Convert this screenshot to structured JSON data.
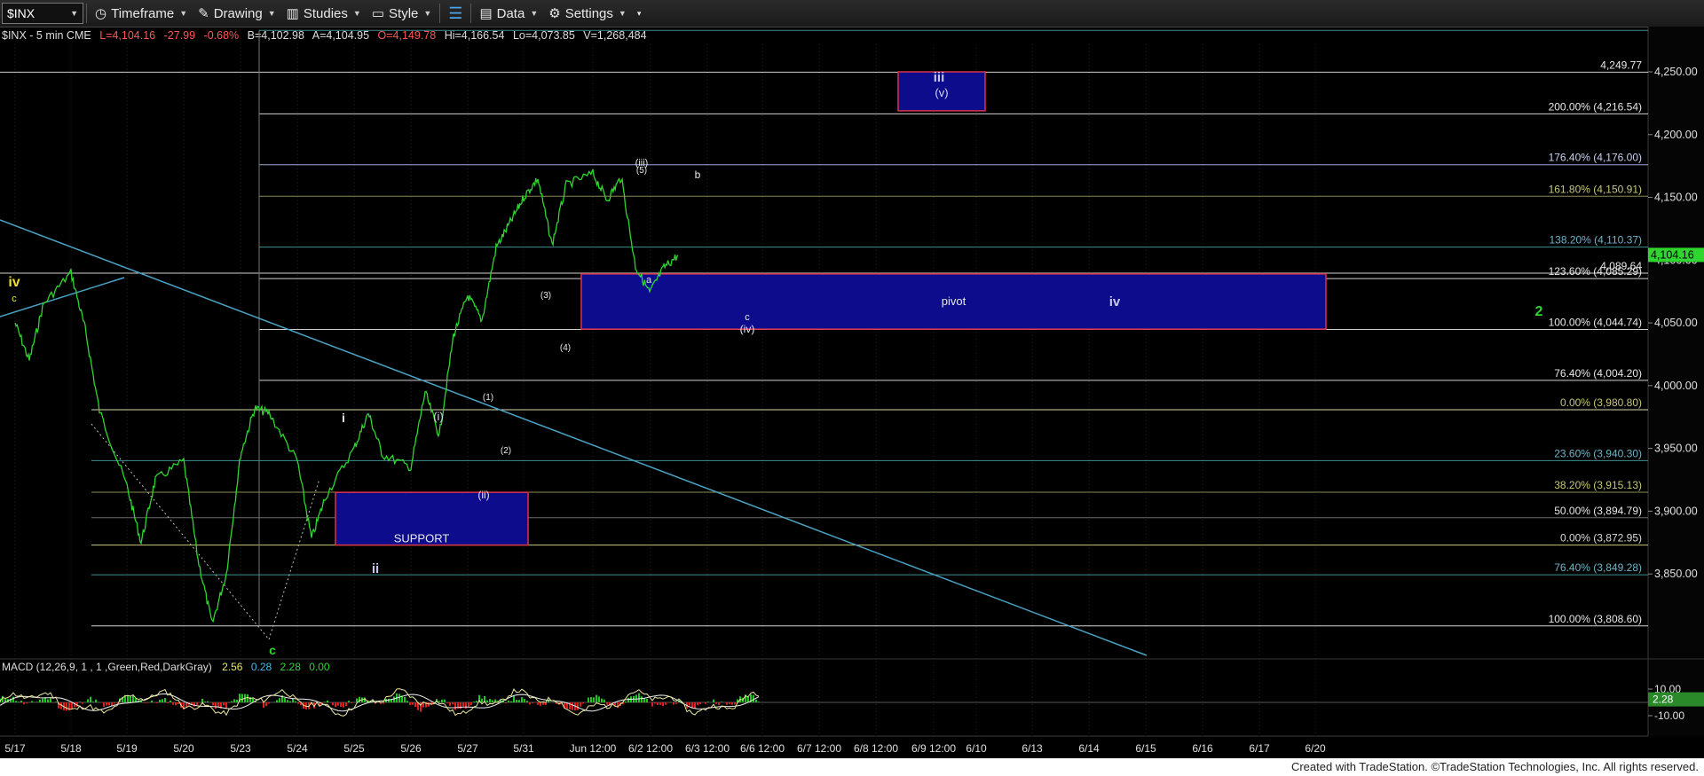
{
  "toolbar": {
    "symbol": "$INX",
    "timeframe": "Timeframe",
    "drawing": "Drawing",
    "studies": "Studies",
    "style": "Style",
    "data": "Data",
    "settings": "Settings"
  },
  "info": {
    "symbol": "$INX - 5 min CME",
    "last": "L=4,104.16",
    "change": "-27.99",
    "pct": "-0.68%",
    "bid": "B=4,102.98",
    "ask": "A=4,104.95",
    "open": "O=4,149.78",
    "hi": "Hi=4,166.54",
    "lo": "Lo=4,073.85",
    "vol": "V=1,268,484"
  },
  "colors": {
    "background": "#000000",
    "price": "#2fd62f",
    "fib_yellow": "#c6c67a",
    "fib_cyan": "#6fb3c8",
    "fib_white": "#d8d8d8",
    "box_fill": "#0c0c8c",
    "box_border": "#d8344a",
    "trendline": "#4aa3c4",
    "macd_line": "#e8e8a0",
    "signal_line": "#f0f0f0",
    "hist_pos": "#1ec81e",
    "hist_neg": "#e02020"
  },
  "chart_data": {
    "type": "line",
    "x_ticks": [
      "5/17",
      "5/18",
      "5/19",
      "5/20",
      "5/23",
      "5/24",
      "5/25",
      "5/26",
      "5/27",
      "5/31",
      "Jun 12:00",
      "6/2 12:00",
      "6/3 12:00",
      "6/6 12:00",
      "6/7 12:00",
      "6/8 12:00",
      "6/9 12:00",
      "6/10",
      "6/13",
      "6/14",
      "6/15",
      "6/16",
      "6/17",
      "6/20"
    ],
    "y_ticks": [
      "4,250.00",
      "4,200.00",
      "4,150.00",
      "4,100.00",
      "4,050.00",
      "4,000.00",
      "3,950.00",
      "3,900.00",
      "3,850.00"
    ],
    "ylim": [
      3800,
      4290
    ],
    "last_price": "4,104.16",
    "price_path": [
      {
        "x": "5/17",
        "y": 4050
      },
      {
        "x": "5/17",
        "y": 4020
      },
      {
        "x": "5/17",
        "y": 4065
      },
      {
        "x": "5/18",
        "y": 4090
      },
      {
        "x": "5/18",
        "y": 4045
      },
      {
        "x": "5/18",
        "y": 3980
      },
      {
        "x": "5/19",
        "y": 3920
      },
      {
        "x": "5/19",
        "y": 3875
      },
      {
        "x": "5/19",
        "y": 3925
      },
      {
        "x": "5/20",
        "y": 3940
      },
      {
        "x": "5/20",
        "y": 3862
      },
      {
        "x": "5/20",
        "y": 3810
      },
      {
        "x": "5/20",
        "y": 3850
      },
      {
        "x": "5/23",
        "y": 3945
      },
      {
        "x": "5/23",
        "y": 3982
      },
      {
        "x": "5/23",
        "y": 3978
      },
      {
        "x": "5/24",
        "y": 3940
      },
      {
        "x": "5/24",
        "y": 3878
      },
      {
        "x": "5/24",
        "y": 3912
      },
      {
        "x": "5/25",
        "y": 3950
      },
      {
        "x": "5/25",
        "y": 3978
      },
      {
        "x": "5/25",
        "y": 3945
      },
      {
        "x": "5/26",
        "y": 3935
      },
      {
        "x": "5/26",
        "y": 3995
      },
      {
        "x": "5/26",
        "y": 3960
      },
      {
        "x": "5/26",
        "y": 4040
      },
      {
        "x": "5/27",
        "y": 4072
      },
      {
        "x": "5/27",
        "y": 4052
      },
      {
        "x": "5/27",
        "y": 4110
      },
      {
        "x": "5/27",
        "y": 4130
      },
      {
        "x": "5/31",
        "y": 4150
      },
      {
        "x": "5/31",
        "y": 4165
      },
      {
        "x": "5/31",
        "y": 4112
      },
      {
        "x": "5/31",
        "y": 4160
      },
      {
        "x": "Jun 12:00",
        "y": 4169
      },
      {
        "x": "Jun 12:00",
        "y": 4148
      },
      {
        "x": "Jun 12:00",
        "y": 4166
      },
      {
        "x": "Jun 12:00",
        "y": 4095
      },
      {
        "x": "Jun 12:00",
        "y": 4074
      },
      {
        "x": "Jun 12:00",
        "y": 4094
      },
      {
        "x": "Jun 12:00",
        "y": 4104
      }
    ],
    "fib_labels": [
      {
        "label": "200.00% (4,216.54)",
        "value": 4216.54
      },
      {
        "label": "176.40% (4,176.00)",
        "value": 4176.0
      },
      {
        "label": "161.80% (4,150.91)",
        "value": 4150.91
      },
      {
        "label": "138.20% (4,110.37)",
        "value": 4110.37
      },
      {
        "label": "123.60% (4,085.29)",
        "value": 4085.29
      },
      {
        "label": "100.00% (4,044.74)",
        "value": 4044.74
      },
      {
        "label": "76.40% (4,004.20)",
        "value": 4004.2
      },
      {
        "label": "0.00% (3,980.80)",
        "value": 3980.8
      },
      {
        "label": "23.60% (3,940.30)",
        "value": 3940.3
      },
      {
        "label": "38.20% (3,915.13)",
        "value": 3915.13
      },
      {
        "label": "50.00% (3,894.79)",
        "value": 3894.79
      },
      {
        "label": "0.00% (3,872.95)",
        "value": 3872.95
      },
      {
        "label": "76.40% (3,849.28)",
        "value": 3849.28
      },
      {
        "label": "100.00% (3,808.60)",
        "value": 3808.6
      }
    ],
    "level_labels": [
      {
        "label": "4,249.77",
        "value": 4249.77
      },
      {
        "label": "4,089.64",
        "value": 4089.64
      }
    ],
    "boxes": [
      {
        "label": "(v)",
        "value_top": 4250,
        "value_bottom": 4219
      },
      {
        "label": "pivot",
        "value_top": 4089,
        "value_bottom": 4045
      },
      {
        "label": "SUPPORT",
        "value_top": 3915,
        "value_bottom": 3873
      }
    ],
    "wave_labels": [
      "iv",
      "c",
      "c",
      "i",
      "ii",
      "(i)",
      "(ii)",
      "(1)",
      "(2)",
      "(3)",
      "(4)",
      "(5)",
      "(iii)",
      "a",
      "b",
      "c",
      "(iv)",
      "iii",
      "iv",
      "2"
    ],
    "macd": {
      "label": "MACD (12,26,9, 1 , 1 ,Green,Red,DarkGray)",
      "values": [
        "2.56",
        "0.28",
        "2.28",
        "0.00"
      ],
      "y_ticks": [
        "10.00",
        "2.28",
        "-10.00"
      ]
    }
  },
  "footer": "Created with TradeStation. ©TradeStation Technologies, Inc. All rights reserved."
}
